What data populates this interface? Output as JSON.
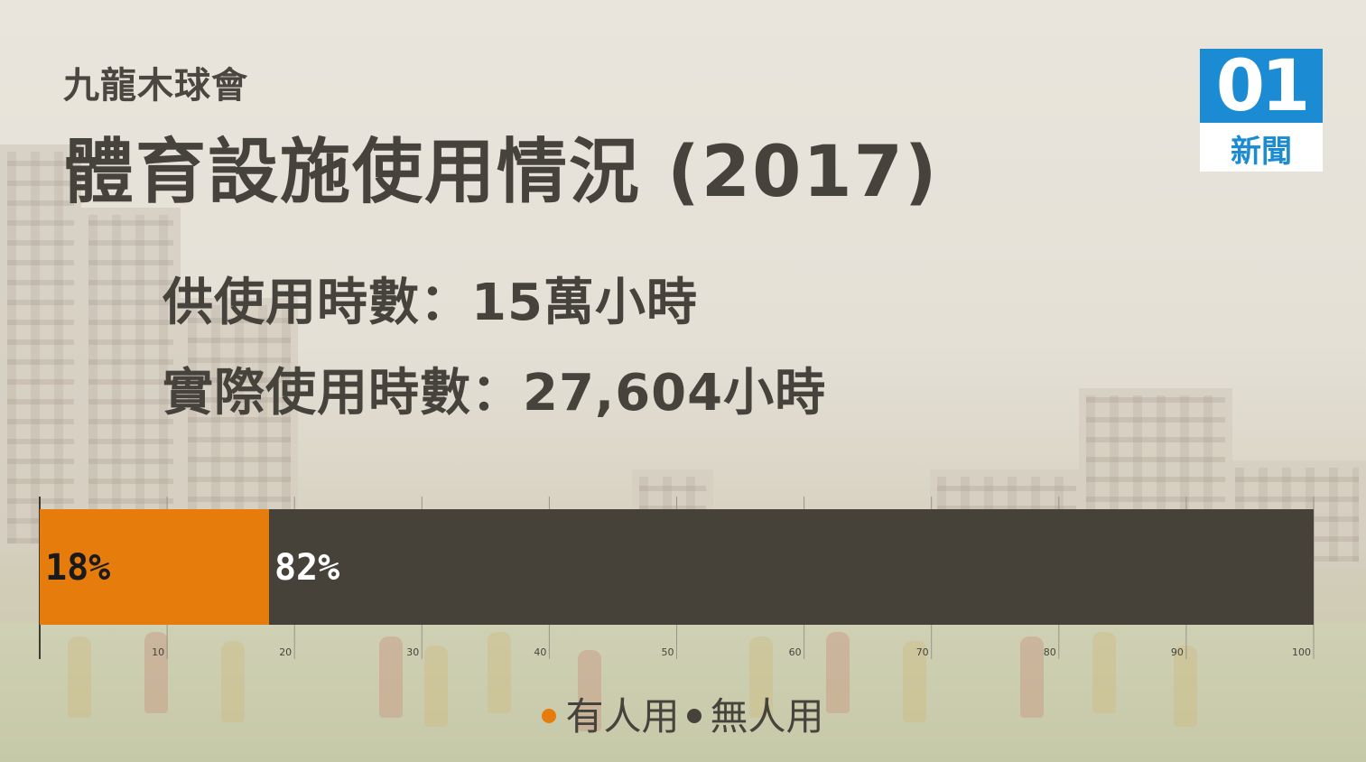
{
  "header": {
    "subtitle": "九龍木球會",
    "title": "體育設施使用情況 (2017)"
  },
  "stats": {
    "line1": "供使用時數：15萬小時",
    "line2": "實際使用時數：27,604小時"
  },
  "logo": {
    "number": "01",
    "text": "新聞"
  },
  "colors": {
    "used": "#e57c0b",
    "unused": "#46423a",
    "text": "#46433d",
    "logo_blue": "#1b8bd3"
  },
  "chart_data": {
    "type": "bar",
    "orientation": "horizontal",
    "stacked": true,
    "xlim": [
      0,
      100
    ],
    "x_ticks": [
      "10",
      "20",
      "30",
      "40",
      "50",
      "60",
      "70",
      "80",
      "90",
      "100"
    ],
    "series": [
      {
        "name": "有人用",
        "values": [
          18
        ],
        "label": "18%",
        "color": "#e57c0b"
      },
      {
        "name": "無人用",
        "values": [
          82
        ],
        "label": "82%",
        "color": "#46423a"
      }
    ],
    "grid": true,
    "legend_position": "bottom"
  }
}
